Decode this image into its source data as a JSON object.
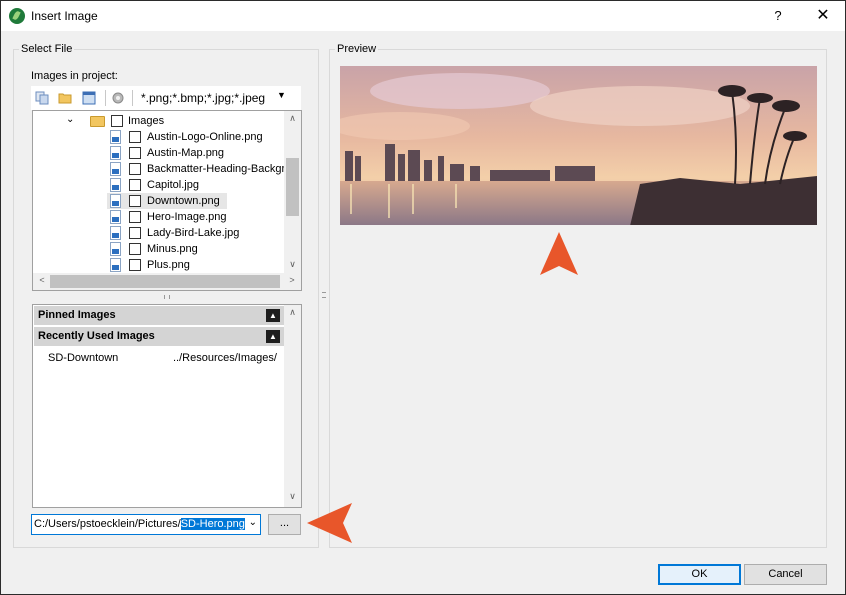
{
  "window": {
    "title": "Insert Image",
    "help_label": "?",
    "close_label": "✕"
  },
  "select_file": {
    "legend": "Select File",
    "images_label": "Images in project:",
    "toolbar_icons": [
      "copy-icon",
      "open-folder-icon",
      "thumbnail-view-icon",
      "settings-icon"
    ],
    "filter": "*.png;*.bmp;*.jpg;*.jpeg",
    "tree": {
      "folder": "Images",
      "files": [
        "Austin-Logo-Online.png",
        "Austin-Map.png",
        "Backmatter-Heading-Backgro",
        "Capitol.jpg",
        "Downtown.png",
        "Hero-Image.png",
        "Lady-Bird-Lake.jpg",
        "Minus.png",
        "Plus.png"
      ],
      "selected_index": 4
    },
    "pinned_header": "Pinned Images",
    "recent_header": "Recently Used Images",
    "recent_items": [
      {
        "name": "SD-Downtown",
        "path": "../Resources/Images/"
      }
    ],
    "path_prefix": "C:/Users/pstoecklein/Pictures/",
    "path_selected": "SD-Hero.png",
    "browse_label": "..."
  },
  "preview": {
    "legend": "Preview"
  },
  "footer": {
    "ok_label": "OK",
    "cancel_label": "Cancel"
  },
  "colors": {
    "accent": "#0078d7",
    "callout_arrow": "#e8562a"
  }
}
